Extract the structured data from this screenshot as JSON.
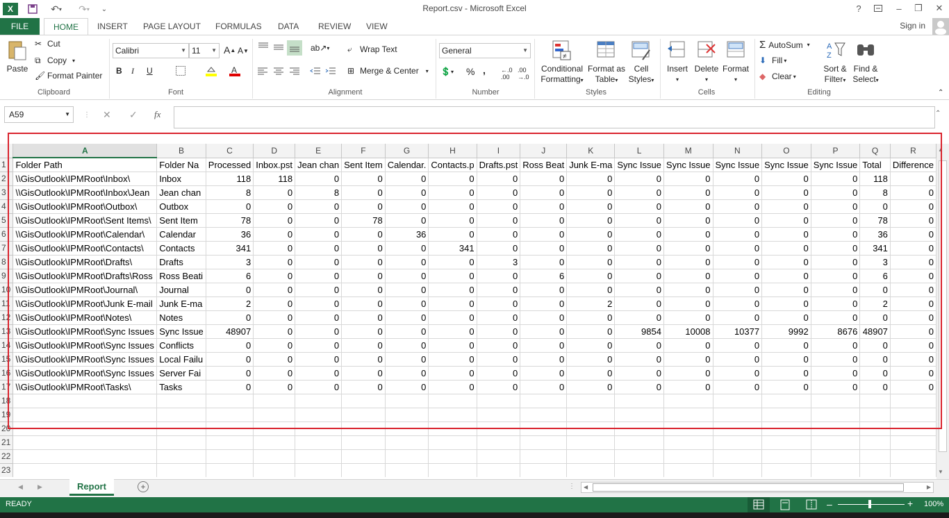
{
  "window": {
    "title": "Report.csv - Microsoft Excel",
    "help": "?",
    "min": "–",
    "max": "❐",
    "close": "✕"
  },
  "tabs": {
    "file": "FILE",
    "items": [
      "HOME",
      "INSERT",
      "PAGE LAYOUT",
      "FORMULAS",
      "DATA",
      "REVIEW",
      "VIEW"
    ],
    "signin": "Sign in"
  },
  "ribbon": {
    "clipboard": {
      "paste": "Paste",
      "cut": "Cut",
      "copy": "Copy",
      "format_painter": "Format Painter",
      "label": "Clipboard"
    },
    "font": {
      "name": "Calibri",
      "size": "11",
      "bold": "B",
      "italic": "I",
      "underline": "U",
      "label": "Font"
    },
    "alignment": {
      "wrap": "Wrap Text",
      "merge": "Merge & Center",
      "label": "Alignment"
    },
    "number": {
      "format": "General",
      "percent": "%",
      "comma": ",",
      "label": "Number"
    },
    "styles": {
      "conditional": "Conditional",
      "conditional2": "Formatting",
      "format_as": "Format as",
      "format_as2": "Table",
      "cell": "Cell",
      "cell2": "Styles",
      "label": "Styles"
    },
    "cells": {
      "insert": "Insert",
      "delete": "Delete",
      "format": "Format",
      "label": "Cells"
    },
    "editing": {
      "autosum": "AutoSum",
      "fill": "Fill",
      "clear": "Clear",
      "sort": "Sort &",
      "sort2": "Filter",
      "find": "Find &",
      "find2": "Select",
      "label": "Editing"
    }
  },
  "formula_bar": {
    "name_box": "A59",
    "fx": "fx",
    "cancel": "✕",
    "enter": "✓",
    "value": ""
  },
  "columns": [
    "A",
    "B",
    "C",
    "D",
    "E",
    "F",
    "G",
    "H",
    "I",
    "J",
    "K",
    "L",
    "M",
    "N",
    "O",
    "P",
    "Q",
    "R"
  ],
  "rows": [
    {
      "n": "1",
      "cells": [
        "Folder Path",
        "Folder Na",
        "Processed",
        "Inbox.pst",
        "Jean chan",
        "Sent Item",
        "Calendar.",
        "Contacts.p",
        "Drafts.pst",
        "Ross Beat",
        "Junk E-ma",
        "Sync Issue",
        "Sync Issue",
        "Sync Issue",
        "Sync Issue",
        "Sync Issue",
        "Total",
        "Difference"
      ]
    },
    {
      "n": "2",
      "cells": [
        "\\\\GisOutlook\\IPMRoot\\Inbox\\",
        "Inbox",
        "118",
        "118",
        "0",
        "0",
        "0",
        "0",
        "0",
        "0",
        "0",
        "0",
        "0",
        "0",
        "0",
        "0",
        "118",
        "0"
      ]
    },
    {
      "n": "3",
      "cells": [
        "\\\\GisOutlook\\IPMRoot\\Inbox\\Jean",
        "Jean chan",
        "8",
        "0",
        "8",
        "0",
        "0",
        "0",
        "0",
        "0",
        "0",
        "0",
        "0",
        "0",
        "0",
        "0",
        "8",
        "0"
      ]
    },
    {
      "n": "4",
      "cells": [
        "\\\\GisOutlook\\IPMRoot\\Outbox\\",
        "Outbox",
        "0",
        "0",
        "0",
        "0",
        "0",
        "0",
        "0",
        "0",
        "0",
        "0",
        "0",
        "0",
        "0",
        "0",
        "0",
        "0"
      ]
    },
    {
      "n": "5",
      "cells": [
        "\\\\GisOutlook\\IPMRoot\\Sent Items\\",
        "Sent Item",
        "78",
        "0",
        "0",
        "78",
        "0",
        "0",
        "0",
        "0",
        "0",
        "0",
        "0",
        "0",
        "0",
        "0",
        "78",
        "0"
      ]
    },
    {
      "n": "6",
      "cells": [
        "\\\\GisOutlook\\IPMRoot\\Calendar\\",
        "Calendar",
        "36",
        "0",
        "0",
        "0",
        "36",
        "0",
        "0",
        "0",
        "0",
        "0",
        "0",
        "0",
        "0",
        "0",
        "36",
        "0"
      ]
    },
    {
      "n": "7",
      "cells": [
        "\\\\GisOutlook\\IPMRoot\\Contacts\\",
        "Contacts",
        "341",
        "0",
        "0",
        "0",
        "0",
        "341",
        "0",
        "0",
        "0",
        "0",
        "0",
        "0",
        "0",
        "0",
        "341",
        "0"
      ]
    },
    {
      "n": "8",
      "cells": [
        "\\\\GisOutlook\\IPMRoot\\Drafts\\",
        "Drafts",
        "3",
        "0",
        "0",
        "0",
        "0",
        "0",
        "3",
        "0",
        "0",
        "0",
        "0",
        "0",
        "0",
        "0",
        "3",
        "0"
      ]
    },
    {
      "n": "9",
      "cells": [
        "\\\\GisOutlook\\IPMRoot\\Drafts\\Ross",
        "Ross Beati",
        "6",
        "0",
        "0",
        "0",
        "0",
        "0",
        "0",
        "6",
        "0",
        "0",
        "0",
        "0",
        "0",
        "0",
        "6",
        "0"
      ]
    },
    {
      "n": "10",
      "cells": [
        "\\\\GisOutlook\\IPMRoot\\Journal\\",
        "Journal",
        "0",
        "0",
        "0",
        "0",
        "0",
        "0",
        "0",
        "0",
        "0",
        "0",
        "0",
        "0",
        "0",
        "0",
        "0",
        "0"
      ]
    },
    {
      "n": "11",
      "cells": [
        "\\\\GisOutlook\\IPMRoot\\Junk E-mail",
        "Junk E-ma",
        "2",
        "0",
        "0",
        "0",
        "0",
        "0",
        "0",
        "0",
        "2",
        "0",
        "0",
        "0",
        "0",
        "0",
        "2",
        "0"
      ]
    },
    {
      "n": "12",
      "cells": [
        "\\\\GisOutlook\\IPMRoot\\Notes\\",
        "Notes",
        "0",
        "0",
        "0",
        "0",
        "0",
        "0",
        "0",
        "0",
        "0",
        "0",
        "0",
        "0",
        "0",
        "0",
        "0",
        "0"
      ]
    },
    {
      "n": "13",
      "cells": [
        "\\\\GisOutlook\\IPMRoot\\Sync Issues",
        "Sync Issue",
        "48907",
        "0",
        "0",
        "0",
        "0",
        "0",
        "0",
        "0",
        "0",
        "9854",
        "10008",
        "10377",
        "9992",
        "8676",
        "48907",
        "0"
      ]
    },
    {
      "n": "14",
      "cells": [
        "\\\\GisOutlook\\IPMRoot\\Sync Issues",
        "Conflicts",
        "0",
        "0",
        "0",
        "0",
        "0",
        "0",
        "0",
        "0",
        "0",
        "0",
        "0",
        "0",
        "0",
        "0",
        "0",
        "0"
      ]
    },
    {
      "n": "15",
      "cells": [
        "\\\\GisOutlook\\IPMRoot\\Sync Issues",
        "Local Failu",
        "0",
        "0",
        "0",
        "0",
        "0",
        "0",
        "0",
        "0",
        "0",
        "0",
        "0",
        "0",
        "0",
        "0",
        "0",
        "0"
      ]
    },
    {
      "n": "16",
      "cells": [
        "\\\\GisOutlook\\IPMRoot\\Sync Issues",
        "Server Fai",
        "0",
        "0",
        "0",
        "0",
        "0",
        "0",
        "0",
        "0",
        "0",
        "0",
        "0",
        "0",
        "0",
        "0",
        "0",
        "0"
      ]
    },
    {
      "n": "17",
      "cells": [
        "\\\\GisOutlook\\IPMRoot\\Tasks\\",
        "Tasks",
        "0",
        "0",
        "0",
        "0",
        "0",
        "0",
        "0",
        "0",
        "0",
        "0",
        "0",
        "0",
        "0",
        "0",
        "0",
        "0"
      ]
    },
    {
      "n": "18",
      "cells": []
    },
    {
      "n": "19",
      "cells": []
    },
    {
      "n": "20",
      "cells": []
    },
    {
      "n": "21",
      "cells": []
    },
    {
      "n": "22",
      "cells": []
    },
    {
      "n": "23",
      "cells": []
    }
  ],
  "sheet": {
    "tab": "Report",
    "add": "+"
  },
  "status": {
    "ready": "READY",
    "zoom": "100%",
    "minus": "–",
    "plus": "+"
  }
}
